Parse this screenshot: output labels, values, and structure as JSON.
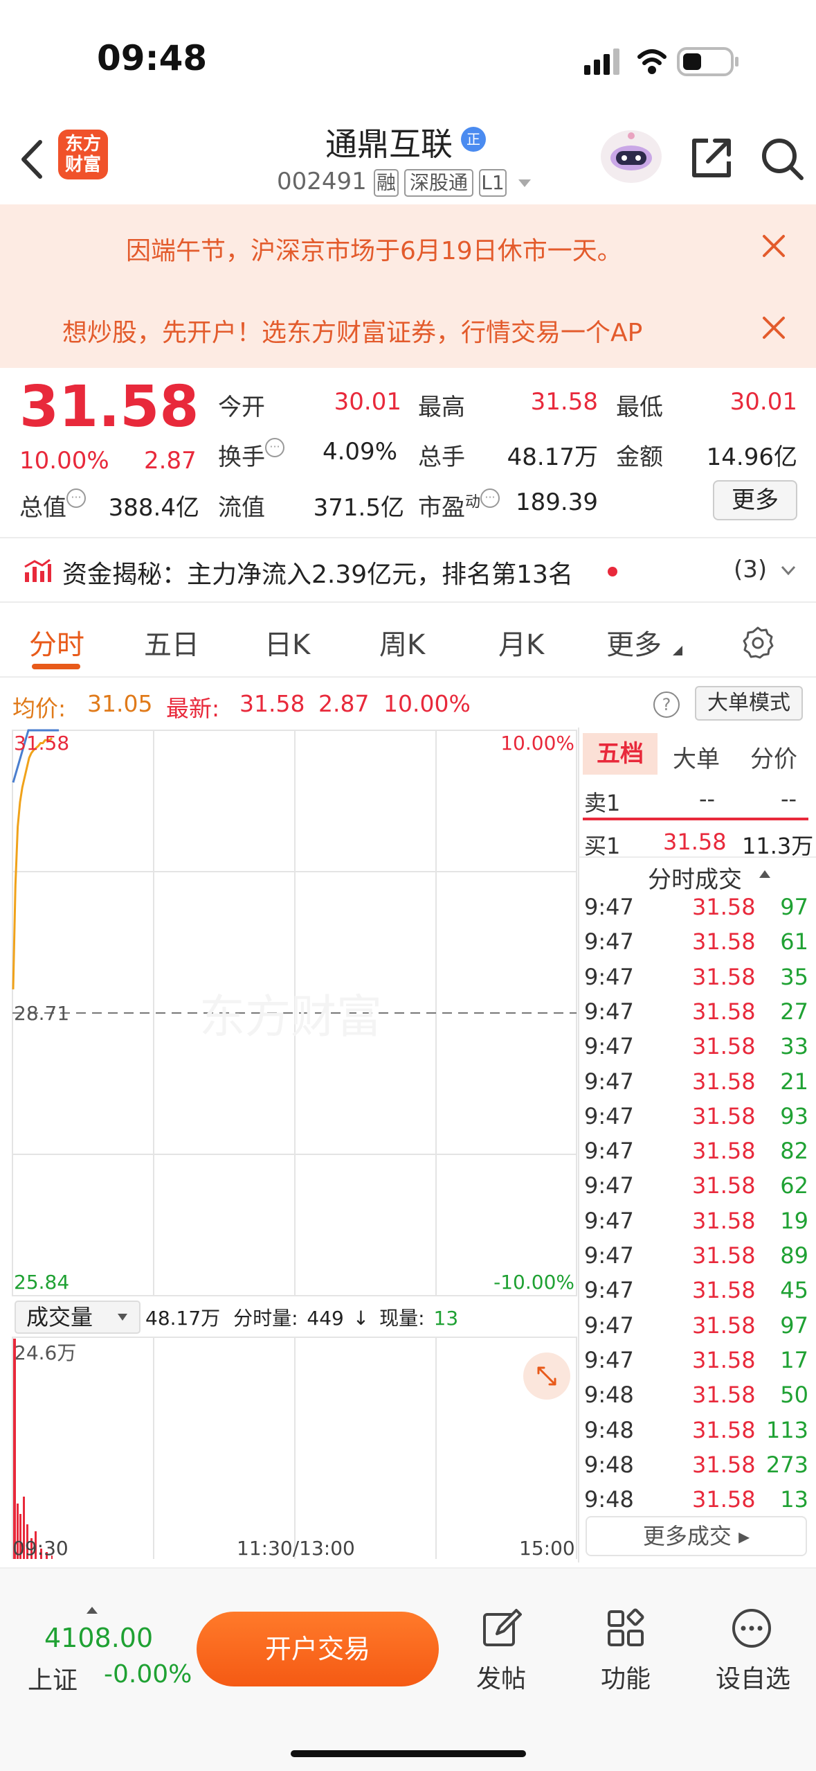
{
  "status_bar": {
    "time": "09:48"
  },
  "header": {
    "logo_line1": "东方",
    "logo_line2": "财富",
    "title": "通鼎互联",
    "verify_badge": "正",
    "code": "002491",
    "tags": [
      "融",
      "深股通",
      "L1"
    ]
  },
  "banners": [
    {
      "text": "因端午节，沪深京市场于6月19日休市一天。"
    },
    {
      "text": "想炒股，先开户！选东方财富证券，行情交易一个AP"
    }
  ],
  "quote": {
    "price": "31.58",
    "change_pct": "10.00%",
    "change": "2.87",
    "open_label": "今开",
    "open": "30.01",
    "high_label": "最高",
    "high": "31.58",
    "low_label": "最低",
    "low": "30.01",
    "turnover_label": "换手",
    "turnover": "4.09%",
    "volume_label": "总手",
    "volume": "48.17万",
    "amount_label": "金额",
    "amount": "14.96亿",
    "mktcap_label": "总值",
    "mktcap": "388.4亿",
    "float_label": "流值",
    "float": "371.5亿",
    "pe_label": "市盈",
    "pe_sup": "动",
    "pe": "189.39",
    "more_label": "更多"
  },
  "fund_flow": {
    "text": "资金揭秘：主力净流入2.39亿元，排名第13名",
    "count": "(3)"
  },
  "tabs": [
    "分时",
    "五日",
    "日K",
    "周K",
    "月K",
    "更多"
  ],
  "info_row": {
    "avg_label": "均价:",
    "avg": "31.05",
    "latest_label": "最新:",
    "latest": "31.58",
    "change": "2.87",
    "pct": "10.00%",
    "help": "?",
    "big_order_label": "大单模式"
  },
  "chart_labels": {
    "price_top": "31.58",
    "pct_top": "10.00%",
    "price_mid": "28.71",
    "price_bottom": "25.84",
    "pct_bottom": "-10.00%",
    "watermark": "东方财富",
    "vol_selector": "成交量",
    "vol_total": "48.17万",
    "vol_period_label": "分时量:",
    "vol_period": "449",
    "vol_arrow": "↓",
    "vol_now_label": "现量:",
    "vol_now": "13",
    "vol_max": "24.6万",
    "time_start": "09:30",
    "time_mid": "11:30/13:00",
    "time_end": "15:00"
  },
  "chart_data": {
    "type": "line",
    "ylim": [
      25.84,
      31.58
    ],
    "y_ticks": [
      "31.58",
      "28.71",
      "25.84"
    ],
    "x_ticks": [
      "09:30",
      "11:30/13:00",
      "15:00"
    ],
    "series": [
      {
        "values": [
          28.95,
          30.01,
          30.6,
          30.85,
          31.0,
          31.1,
          31.2,
          31.3,
          31.35,
          31.38,
          31.4,
          31.42,
          31.45,
          31.45,
          31.48,
          31.48,
          31.48,
          31.5
        ]
      },
      {
        "values": [
          31.05,
          31.58,
          31.58,
          31.58
        ]
      }
    ]
  },
  "order_book": {
    "tabs": [
      "五档",
      "大单",
      "分价"
    ],
    "sell1_label": "卖1",
    "sell1_price": "--",
    "sell1_vol": "--",
    "buy1_label": "买1",
    "buy1_price": "31.58",
    "buy1_vol": "11.3万",
    "ticks_header": "分时成交",
    "more_ticks": "更多成交"
  },
  "ticks": [
    {
      "time": "9:47",
      "price": "31.58",
      "vol": "97"
    },
    {
      "time": "9:47",
      "price": "31.58",
      "vol": "61"
    },
    {
      "time": "9:47",
      "price": "31.58",
      "vol": "35"
    },
    {
      "time": "9:47",
      "price": "31.58",
      "vol": "27"
    },
    {
      "time": "9:47",
      "price": "31.58",
      "vol": "33"
    },
    {
      "time": "9:47",
      "price": "31.58",
      "vol": "21"
    },
    {
      "time": "9:47",
      "price": "31.58",
      "vol": "93"
    },
    {
      "time": "9:47",
      "price": "31.58",
      "vol": "82"
    },
    {
      "time": "9:47",
      "price": "31.58",
      "vol": "62"
    },
    {
      "time": "9:47",
      "price": "31.58",
      "vol": "19"
    },
    {
      "time": "9:47",
      "price": "31.58",
      "vol": "89"
    },
    {
      "time": "9:47",
      "price": "31.58",
      "vol": "45"
    },
    {
      "time": "9:47",
      "price": "31.58",
      "vol": "97"
    },
    {
      "time": "9:47",
      "price": "31.58",
      "vol": "17"
    },
    {
      "time": "9:48",
      "price": "31.58",
      "vol": "50"
    },
    {
      "time": "9:48",
      "price": "31.58",
      "vol": "113"
    },
    {
      "time": "9:48",
      "price": "31.58",
      "vol": "273"
    },
    {
      "time": "9:48",
      "price": "31.58",
      "vol": "13"
    }
  ],
  "bottom_bar": {
    "index_value": "4108.00",
    "index_name": "上证",
    "index_change": "-0.00%",
    "trade_button": "开户交易",
    "post_label": "发帖",
    "func_label": "功能",
    "watch_label": "设自选"
  }
}
